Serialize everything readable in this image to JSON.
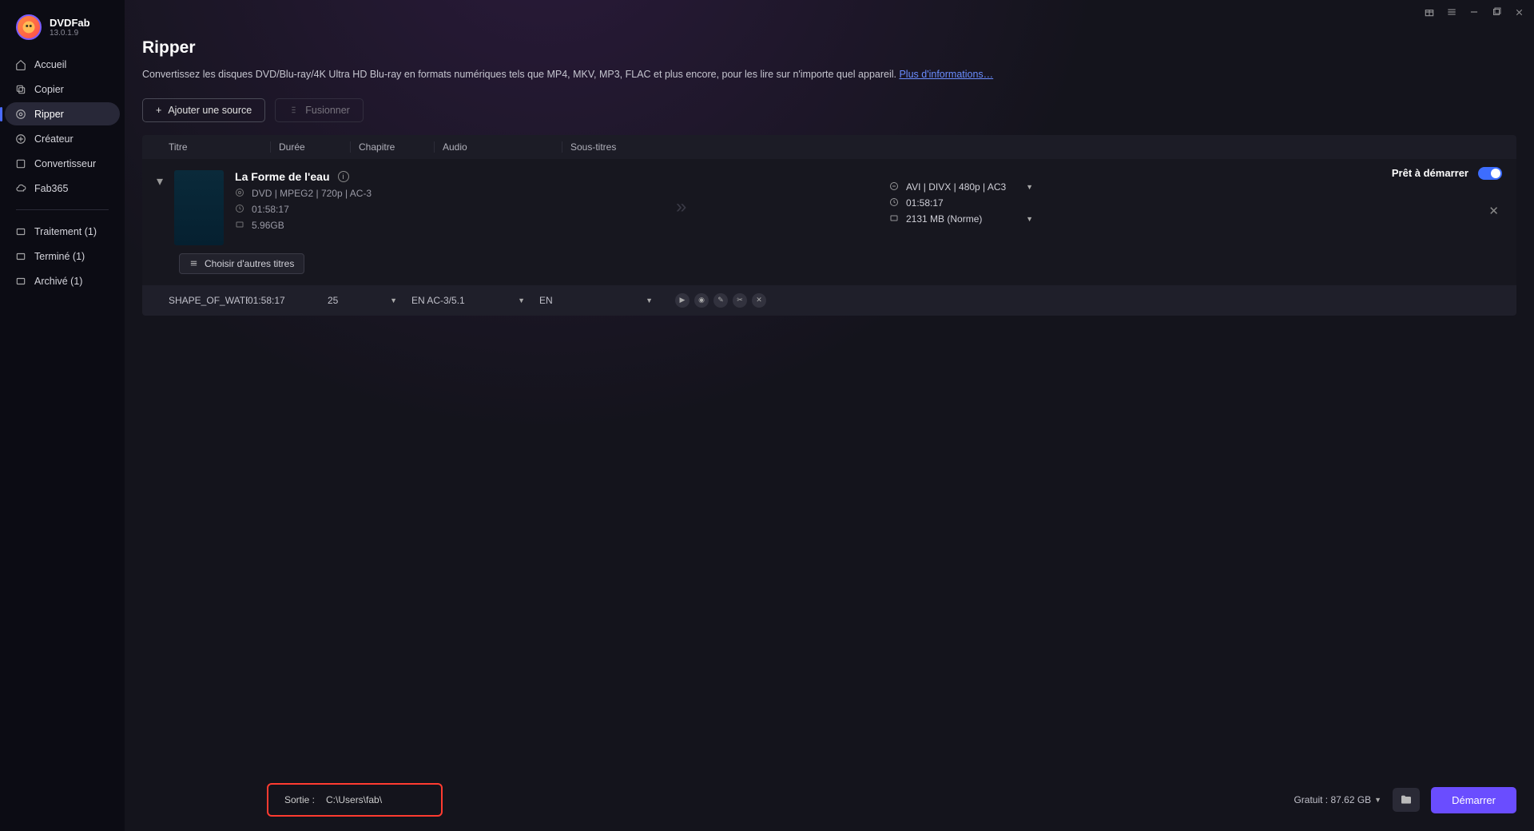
{
  "app": {
    "name": "DVDFab",
    "version": "13.0.1.9"
  },
  "sidebar": {
    "items": [
      {
        "label": "Accueil"
      },
      {
        "label": "Copier"
      },
      {
        "label": "Ripper"
      },
      {
        "label": "Créateur"
      },
      {
        "label": "Convertisseur"
      },
      {
        "label": "Fab365"
      }
    ],
    "tasks": [
      {
        "label": "Traitement (1)"
      },
      {
        "label": "Terminé (1)"
      },
      {
        "label": "Archivé (1)"
      }
    ]
  },
  "page": {
    "title": "Ripper",
    "description": "Convertissez les disques DVD/Blu-ray/4K Ultra HD Blu-ray en formats numériques tels que MP4, MKV, MP3, FLAC et plus encore, pour les lire sur n'importe quel appareil. ",
    "more_link": "Plus d'informations…"
  },
  "toolbar": {
    "add_source": "Ajouter une source",
    "merge": "Fusionner"
  },
  "columns": {
    "title": "Titre",
    "duration": "Durée",
    "chapter": "Chapitre",
    "audio": "Audio",
    "subtitles": "Sous-titres"
  },
  "item": {
    "title": "La Forme de l'eau",
    "source_format": "DVD | MPEG2 | 720p | AC-3",
    "duration": "01:58:17",
    "size": "5.96GB",
    "choose_titles": "Choisir d'autres titres",
    "ready": "Prêt à démarrer",
    "output_format": "AVI | DIVX | 480p | AC3",
    "output_duration": "01:58:17",
    "output_size": "2131 MB (Norme)"
  },
  "detail": {
    "file": "SHAPE_OF_WATER.Title",
    "duration": "01:58:17",
    "chapters": "25",
    "audio": "EN  AC-3/5.1",
    "subtitle": "EN"
  },
  "footer": {
    "output_label": "Sortie :",
    "output_path": "C:\\Users\\fab\\",
    "free_space": "Gratuit : 87.62 GB",
    "start": "Démarrer"
  }
}
